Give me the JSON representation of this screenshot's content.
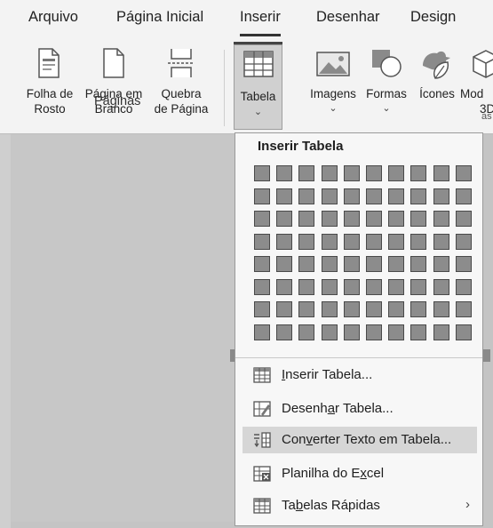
{
  "tabs": {
    "arquivo": "Arquivo",
    "pagina_inicial": "Página Inicial",
    "inserir": "Inserir",
    "desenhar": "Desenhar",
    "design": "Design"
  },
  "ribbon": {
    "folha_rosto": [
      "Folha de",
      "Rosto"
    ],
    "pagina_branco": [
      "Página em",
      "Branco"
    ],
    "quebra_pagina": [
      "Quebra",
      "de Página"
    ],
    "group_paginas": "Páginas",
    "tabela": "Tabela",
    "imagens": "Imagens",
    "formas": "Formas",
    "icones": "Ícones",
    "modelos": [
      "Mod",
      "3D"
    ],
    "clipped_group": "as"
  },
  "dropdown": {
    "title": "Inserir Tabela",
    "grid_cols": 10,
    "grid_rows": 8,
    "items": {
      "inserir": {
        "pre": "",
        "key": "I",
        "post": "nserir Tabela..."
      },
      "desenhar": {
        "pre": "Desenh",
        "key": "a",
        "post": "r Tabela..."
      },
      "converter": {
        "pre": "Con",
        "key": "v",
        "post": "erter Texto em Tabela..."
      },
      "excel": {
        "pre": "Planilha do E",
        "key": "x",
        "post": "cel"
      },
      "rapidas": {
        "pre": "Ta",
        "key": "b",
        "post": "elas Rápidas"
      }
    }
  },
  "colors": {
    "ribbon_bg": "#f3f3f3",
    "doc_bg": "#c4c4c4",
    "cell": "#8c8c8c",
    "highlight": "#d6d6d6"
  }
}
